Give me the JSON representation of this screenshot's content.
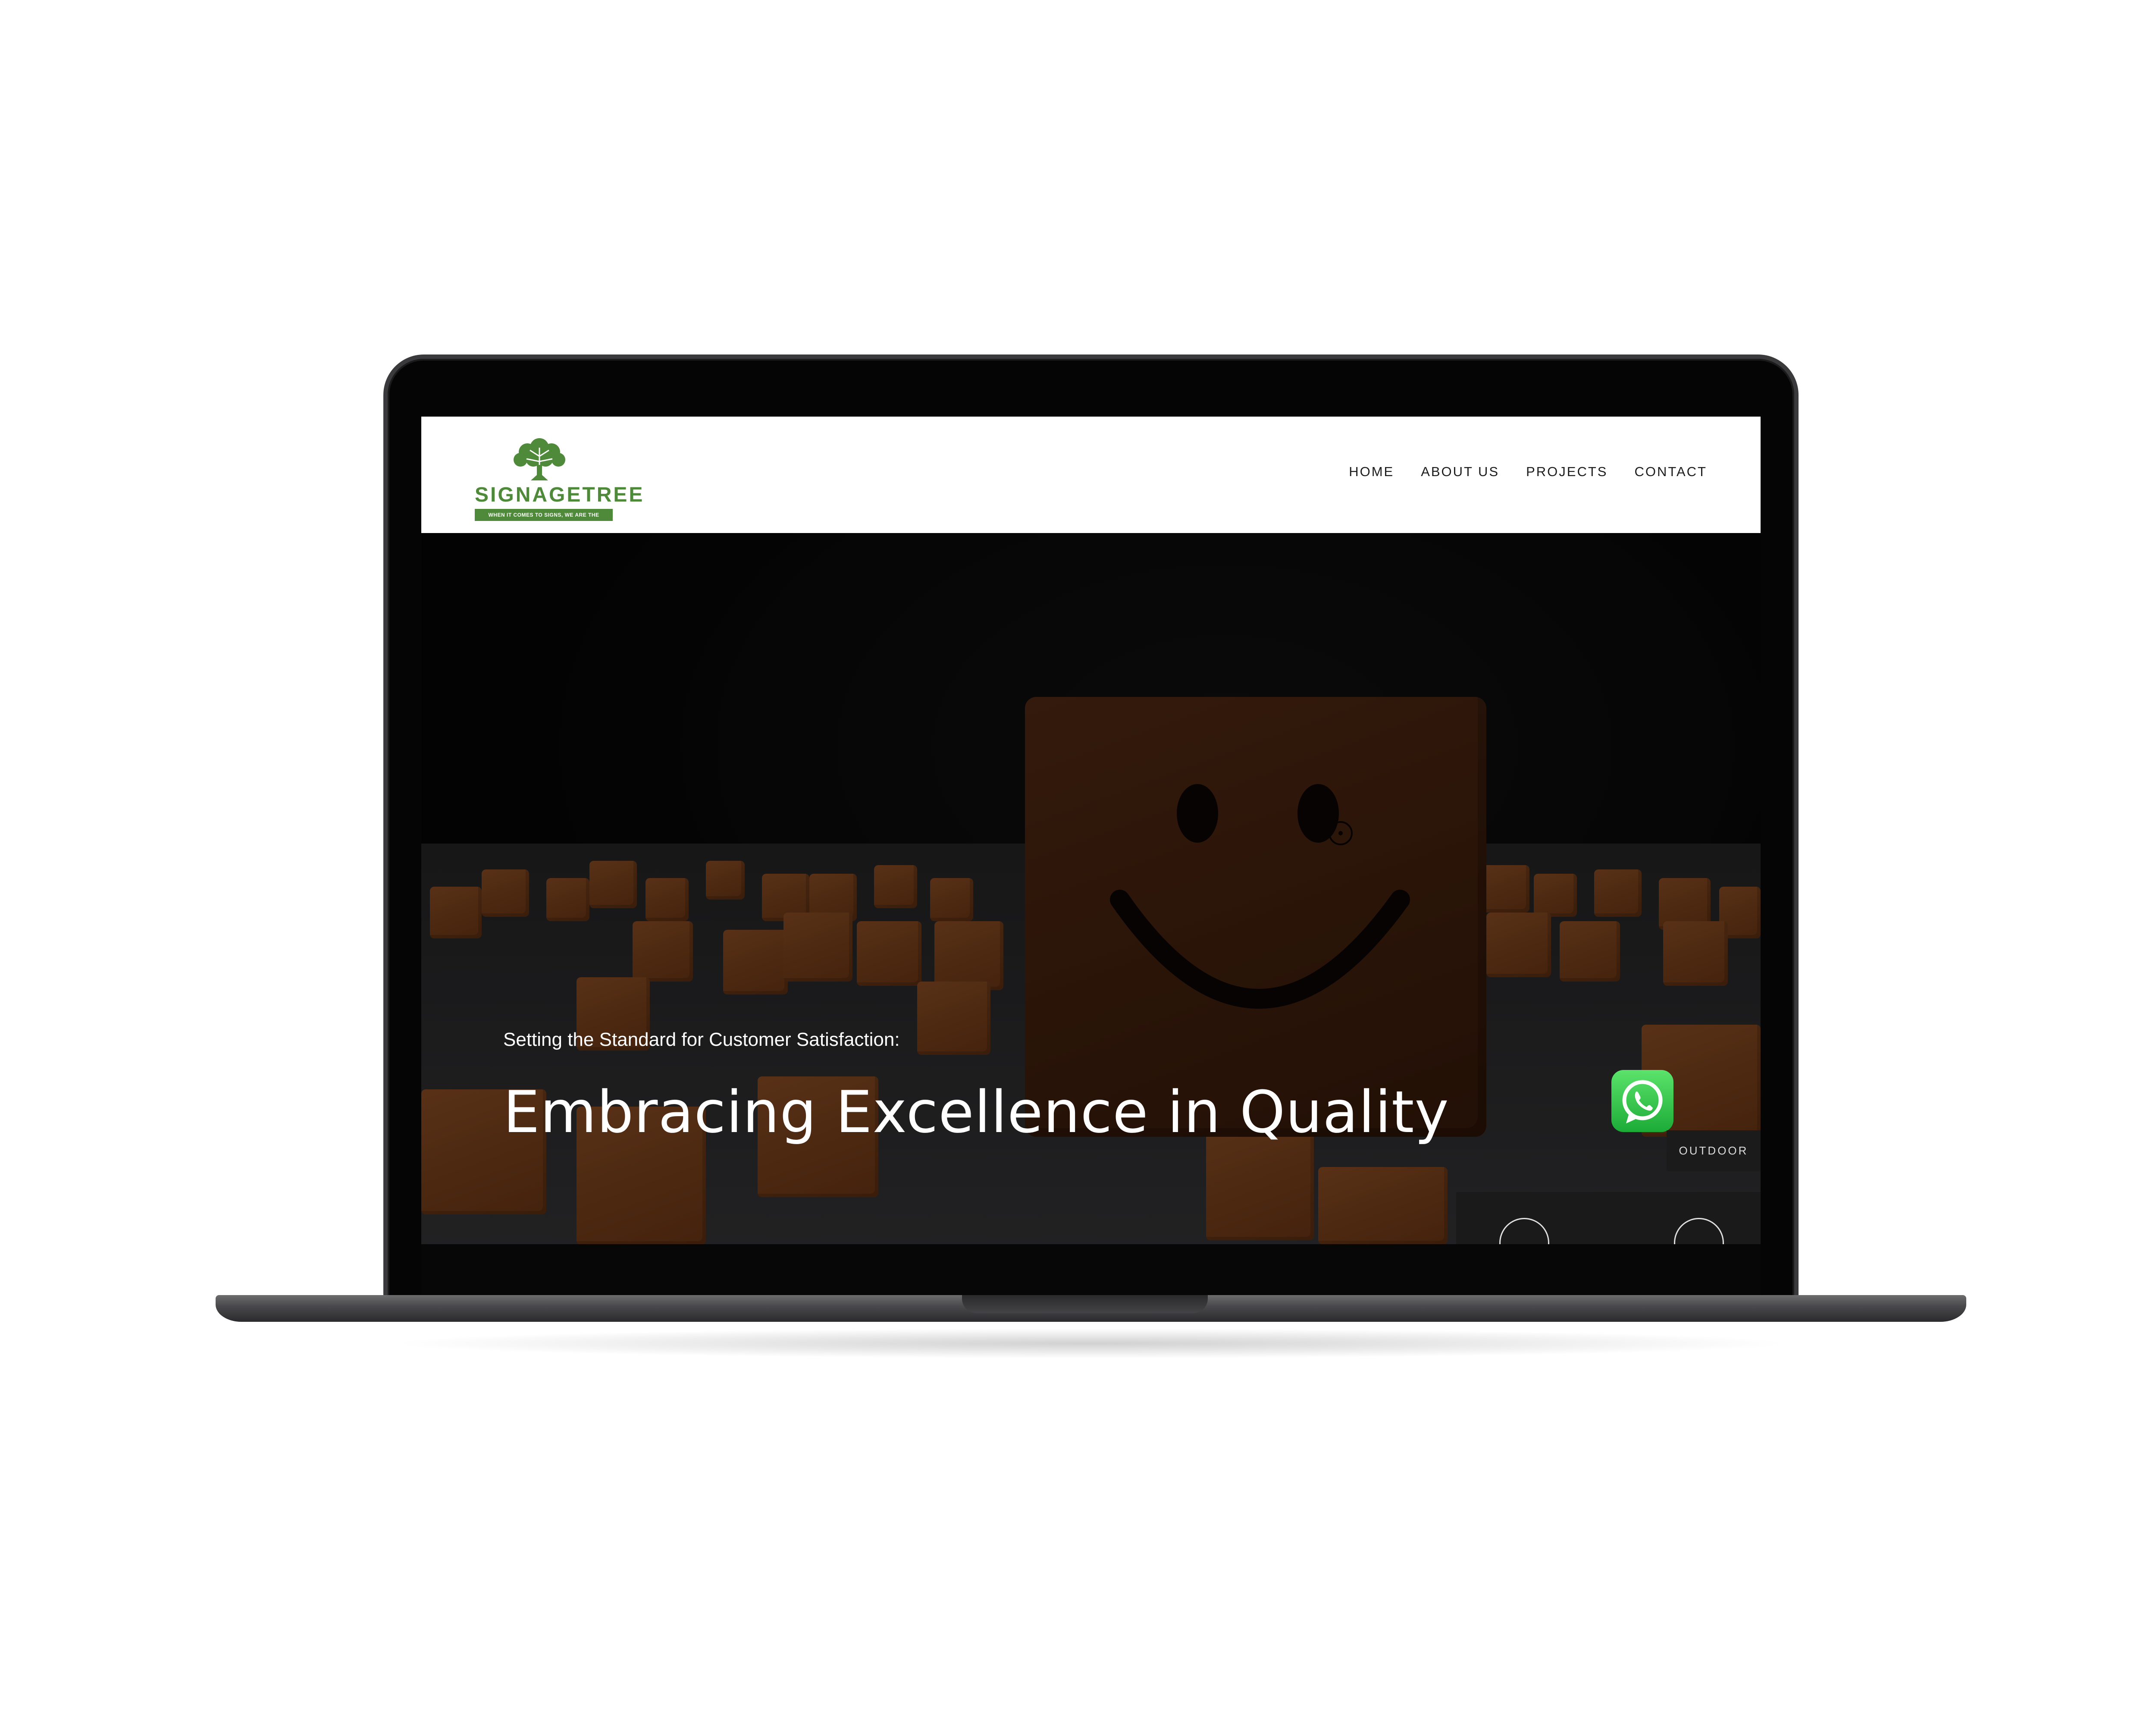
{
  "header": {
    "logo": {
      "wordmark": "SIGNAGETREE",
      "tagline": "WHEN IT COMES TO SIGNS, WE ARE THE SOLUTION"
    },
    "nav": [
      {
        "label": "HOME"
      },
      {
        "label": "ABOUT US"
      },
      {
        "label": "PROJECTS"
      },
      {
        "label": "CONTACT"
      }
    ]
  },
  "hero": {
    "subtitle": "Setting the Standard for Customer Satisfaction:",
    "title": "Embracing Excellence in Quality",
    "category_tag": "OUTDOOR"
  },
  "colors": {
    "brand_green": "#4e8a3a",
    "whatsapp_green": "#25d366",
    "hero_background": "#0a0a0a"
  }
}
